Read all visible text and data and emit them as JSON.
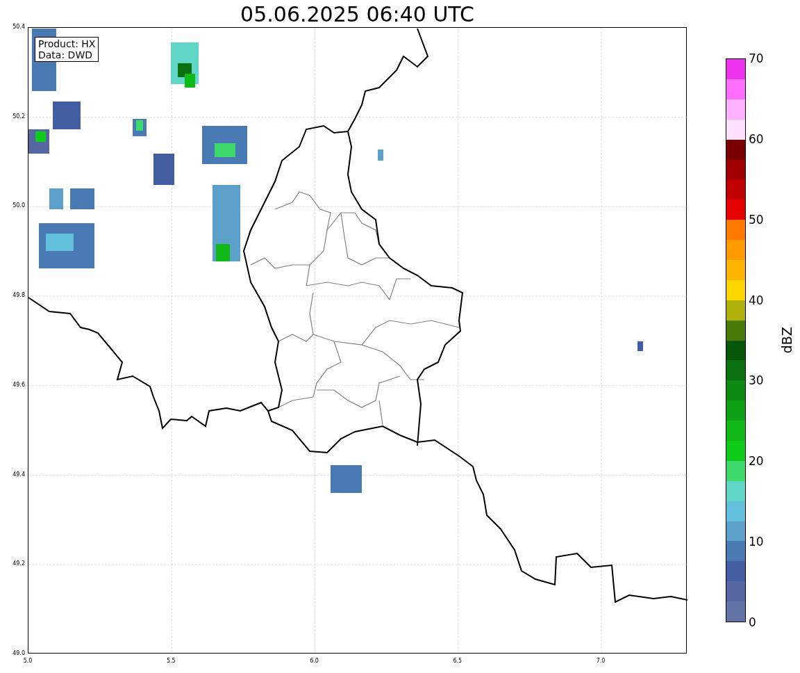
{
  "title": "05.06.2025 06:40 UTC",
  "info_box": [
    "Product: HX",
    "Data: DWD"
  ],
  "map": {
    "x_ticks": [
      "5.0",
      "5.5",
      "6.0",
      "6.5",
      "7.0"
    ],
    "y_ticks": [
      "50.4",
      "50.2",
      "50.0",
      "49.8",
      "49.6",
      "49.4",
      "49.2",
      "49.0"
    ]
  },
  "colorbar": {
    "label": "dBZ",
    "ticks": [
      "70",
      "60",
      "50",
      "40",
      "30",
      "20",
      "10",
      "0"
    ],
    "segments": [
      {
        "color": "#6473a6"
      },
      {
        "color": "#5566a0"
      },
      {
        "color": "#435da3"
      },
      {
        "color": "#4a7ab3"
      },
      {
        "color": "#5aa0c8"
      },
      {
        "color": "#62c0dc"
      },
      {
        "color": "#60d6c6"
      },
      {
        "color": "#3ed96c"
      },
      {
        "color": "#10cc1a"
      },
      {
        "color": "#10b818"
      },
      {
        "color": "#0ea015"
      },
      {
        "color": "#0c8a12"
      },
      {
        "color": "#0a7010"
      },
      {
        "color": "#065808"
      },
      {
        "color": "#4a7a0a"
      },
      {
        "color": "#b0b00a"
      },
      {
        "color": "#ffd700"
      },
      {
        "color": "#ffb400"
      },
      {
        "color": "#ff9a00"
      },
      {
        "color": "#ff7800"
      },
      {
        "color": "#e60000"
      },
      {
        "color": "#c00000"
      },
      {
        "color": "#a00000"
      },
      {
        "color": "#780000"
      },
      {
        "color": "#ffe0ff"
      },
      {
        "color": "#ffb0ff"
      },
      {
        "color": "#ff6eff"
      },
      {
        "color": "#ee33ee"
      }
    ]
  }
}
